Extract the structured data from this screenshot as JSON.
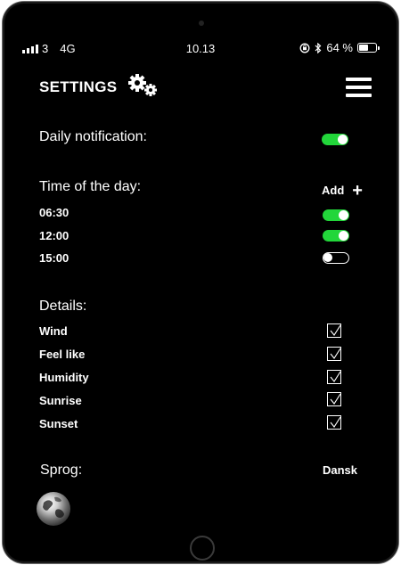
{
  "status_bar": {
    "carrier": "3",
    "network": "4G",
    "time": "10.13",
    "battery": "64 %",
    "battery_level": 0.64
  },
  "header": {
    "title": "SETTINGS"
  },
  "notifications": {
    "label": "Daily notification:",
    "enabled": true
  },
  "time_of_day": {
    "label": "Time of the day:",
    "add_label": "Add",
    "add_icon": "+",
    "times": [
      {
        "time": "06:30",
        "enabled": true
      },
      {
        "time": "12:00",
        "enabled": true
      },
      {
        "time": "15:00",
        "enabled": false
      }
    ]
  },
  "details": {
    "label": "Details:",
    "items": [
      {
        "label": "Wind",
        "checked": true
      },
      {
        "label": "Feel like",
        "checked": true
      },
      {
        "label": "Humidity",
        "checked": true
      },
      {
        "label": "Sunrise",
        "checked": true
      },
      {
        "label": "Sunset",
        "checked": true
      }
    ]
  },
  "language": {
    "label": "Sprog:",
    "value": "Dansk"
  },
  "colors": {
    "background": "#000000",
    "text": "#ffffff",
    "toggle_on": "#22d63a"
  },
  "icons": [
    "signal-icon",
    "rotation-lock-icon",
    "bluetooth-icon",
    "battery-icon",
    "gears-icon",
    "hamburger-menu-icon",
    "plus-icon",
    "check-icon",
    "globe-icon"
  ]
}
